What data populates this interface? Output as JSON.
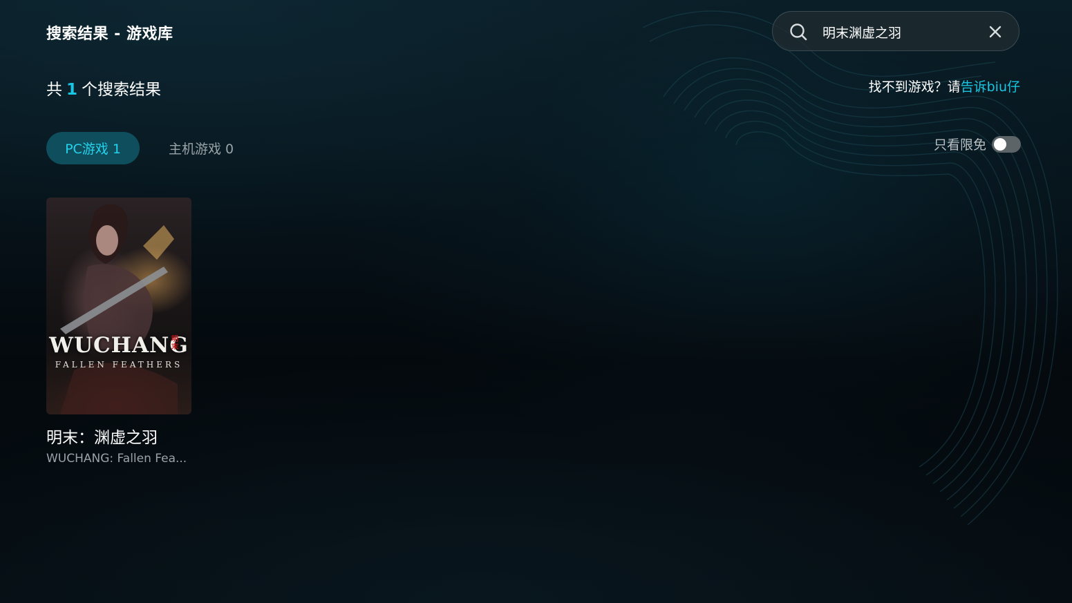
{
  "header": {
    "title": "搜索结果 - 游戏库"
  },
  "search": {
    "value": "明末渊虚之羽",
    "icon": "search-icon",
    "clear_icon": "close-icon"
  },
  "results": {
    "prefix": "共",
    "count": "1",
    "suffix": "个搜索结果"
  },
  "feedback": {
    "text": "找不到游戏？请",
    "link": "告诉biu仔"
  },
  "tabs": [
    {
      "label": "PC游戏 1",
      "active": true
    },
    {
      "label": "主机游戏 0",
      "active": false
    }
  ],
  "filter": {
    "label": "只看限免",
    "enabled": false
  },
  "games": [
    {
      "title": "明末：渊虚之羽",
      "subtitle": "WUCHANG: Fallen Fea...",
      "cover_logo": "WUCHANG",
      "cover_sub": "FALLEN FEATHERS",
      "cover_seal": "明末"
    }
  ],
  "colors": {
    "accent": "#17c7e3",
    "tab_active_bg": "#0f4f5d",
    "muted": "#9aa3a8"
  }
}
